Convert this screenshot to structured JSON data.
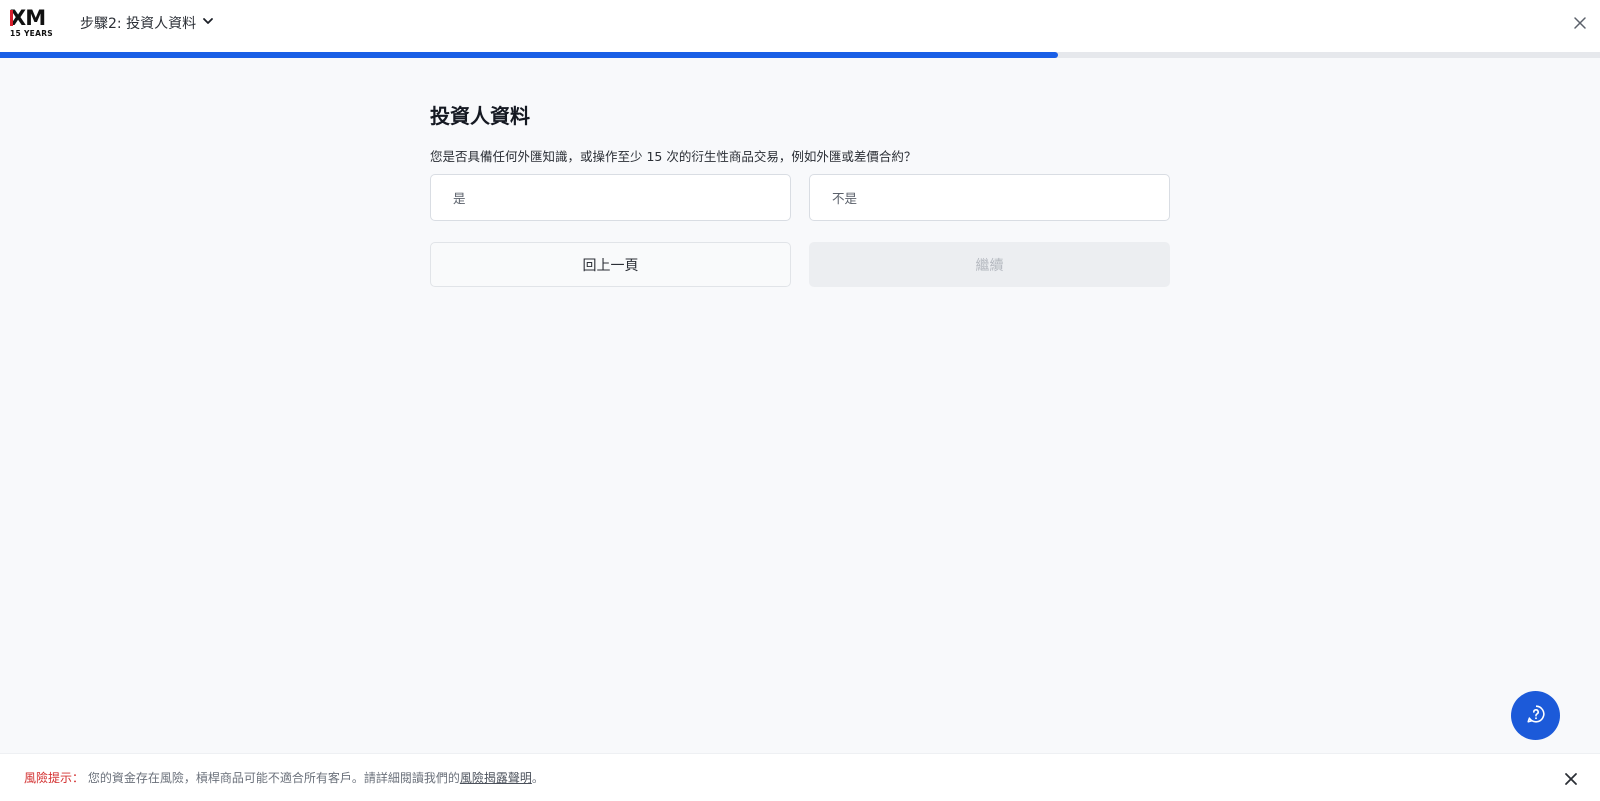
{
  "header": {
    "logo_text": "XM",
    "logo_subtext": "15 YEARS",
    "step_title": "步驟2: 投資人資料"
  },
  "progress": {
    "fraction": 0.661
  },
  "main": {
    "title": "投資人資料",
    "question": "您是否具備任何外匯知識，或操作至少 15 次的衍生性商品交易，例如外匯或差價合約？",
    "options": [
      {
        "label": "是"
      },
      {
        "label": "不是"
      }
    ],
    "back_label": "回上一頁",
    "continue_label": "繼續"
  },
  "risk": {
    "label": "風險提示：",
    "text": " 您的資金存在風險，槓桿商品可能不適合所有客戶。請詳細閱讀我們的",
    "link": "風險揭露聲明",
    "suffix": "。"
  },
  "colors": {
    "accent": "#1a5fe6",
    "chat_button": "#1c5ad9",
    "risk_label": "#d32f2f",
    "logo_red": "#d81e2c"
  },
  "icons": {
    "step_dropdown": "chevron-down-icon",
    "close": "close-icon",
    "chat": "chat-help-icon"
  }
}
